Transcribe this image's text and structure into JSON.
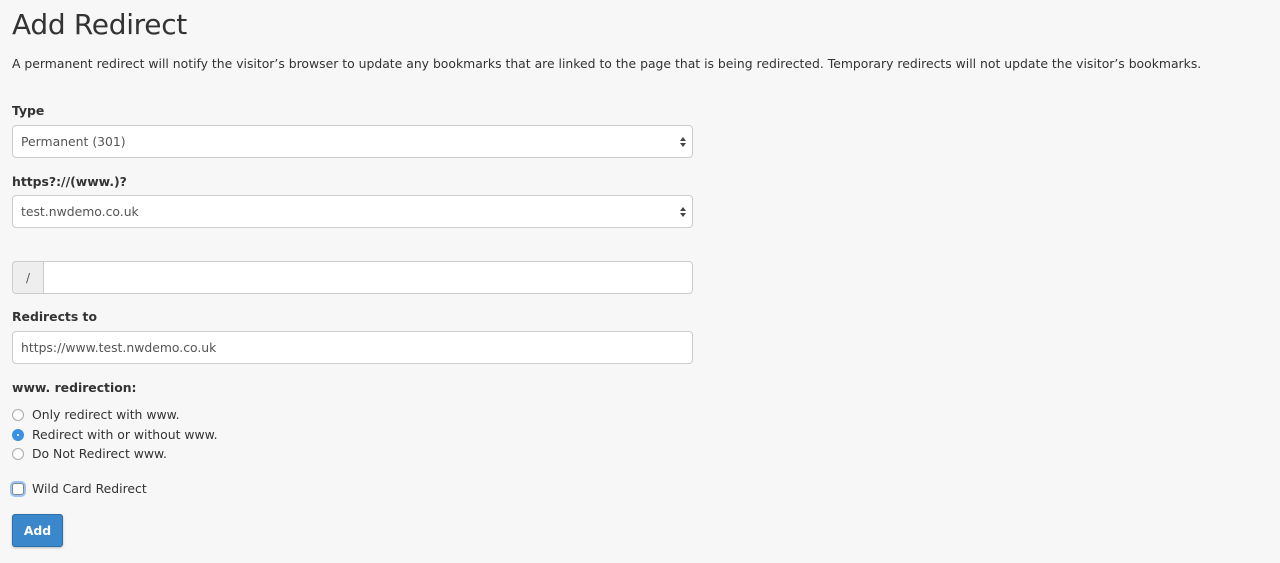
{
  "page": {
    "title": "Add Redirect",
    "description": "A permanent redirect will notify the visitor’s browser to update any bookmarks that are linked to the page that is being redirected. Temporary redirects will not update the visitor’s bookmarks."
  },
  "form": {
    "type": {
      "label": "Type",
      "value": "Permanent (301)"
    },
    "domain": {
      "label": "https?://(www.)?",
      "value": "test.nwdemo.co.uk"
    },
    "path": {
      "prefix": "/",
      "value": ""
    },
    "redirects_to": {
      "label": "Redirects to",
      "value": "https://www.test.nwdemo.co.uk"
    },
    "www_redirection": {
      "label": "www. redirection:",
      "options": [
        {
          "label": "Only redirect with www.",
          "checked": false
        },
        {
          "label": "Redirect with or without www.",
          "checked": true
        },
        {
          "label": "Do Not Redirect www.",
          "checked": false
        }
      ]
    },
    "wildcard": {
      "label": "Wild Card Redirect",
      "checked": false
    },
    "submit_label": "Add"
  },
  "colors": {
    "accent": "#3a87cc",
    "radio_checked": "#3b8fe6",
    "background": "#f7f7f7"
  }
}
